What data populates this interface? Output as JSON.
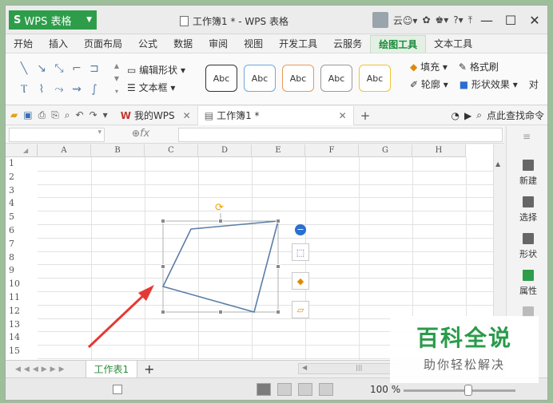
{
  "titlebar": {
    "app_name": "WPS 表格",
    "doc_title": "工作簿1 * - WPS 表格",
    "cloud_label": "云",
    "help_label": "?"
  },
  "menu": {
    "tabs": [
      "开始",
      "插入",
      "页面布局",
      "公式",
      "数据",
      "审阅",
      "视图",
      "开发工具",
      "云服务",
      "绘图工具",
      "文本工具"
    ],
    "active": "绘图工具"
  },
  "ribbon": {
    "edit_shape": "编辑形状",
    "textbox": "文本框",
    "style_label": "Abc",
    "style_colors": [
      "#333333",
      "#6fa8dc",
      "#e69a5a",
      "#9a9a9a",
      "#f1c232"
    ],
    "fill": "填充",
    "format_painter": "格式刷",
    "outline": "轮廓",
    "shape_effect": "形状效果",
    "align_trunc": "对"
  },
  "doctabs": {
    "mywps": "我的WPS",
    "current": "工作簿1 *",
    "find": "点此查找命令"
  },
  "formula": {
    "fx": "fx"
  },
  "grid": {
    "columns": [
      "A",
      "B",
      "C",
      "D",
      "E",
      "F",
      "G",
      "H"
    ],
    "rows": [
      "1",
      "2",
      "3",
      "4",
      "5",
      "6",
      "7",
      "8",
      "9",
      "10",
      "11",
      "12",
      "13",
      "14",
      "15"
    ]
  },
  "right_panel": {
    "new": "新建",
    "select": "选择",
    "shape": "形状",
    "property": "属性"
  },
  "sheetbar": {
    "sheet_name": "工作表1",
    "add": "+"
  },
  "status": {
    "zoom": "100 %"
  },
  "watermark": {
    "line1": "百科全说",
    "line2": "助你轻松解决"
  },
  "colors": {
    "accent_green": "#2e9d4a",
    "shape_stroke": "#5b7ea6",
    "arrow_red": "#e53935"
  }
}
